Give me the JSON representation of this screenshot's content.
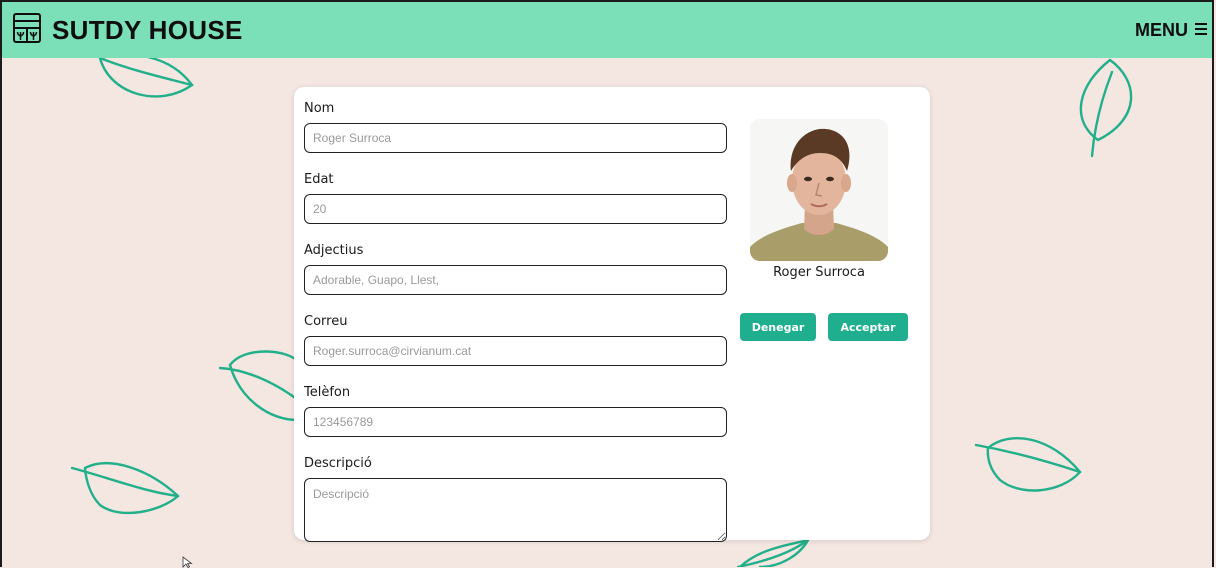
{
  "header": {
    "title": "SUTDY HOUSE",
    "menu_label": "MENU",
    "logo_icon": "greenhouse-icon",
    "menu_icon": "hamburger-icon"
  },
  "colors": {
    "header_bg": "#7bdfb8",
    "page_bg": "#f4e6e1",
    "button_bg": "#1faf8f",
    "leaf_stroke": "#22b08a"
  },
  "form": {
    "fields": [
      {
        "label": "Nom",
        "placeholder": "Roger Surroca"
      },
      {
        "label": "Edat",
        "placeholder": "20"
      },
      {
        "label": "Adjectius",
        "placeholder": "Adorable, Guapo, Llest,"
      },
      {
        "label": "Correu",
        "placeholder": "Roger.surroca@cirvianum.cat"
      },
      {
        "label": "Telèfon",
        "placeholder": "123456789"
      },
      {
        "label": "Descripció",
        "placeholder": "Descripció"
      }
    ]
  },
  "profile": {
    "name": "Roger Surroca"
  },
  "actions": {
    "deny_label": "Denegar",
    "accept_label": "Acceptar"
  }
}
